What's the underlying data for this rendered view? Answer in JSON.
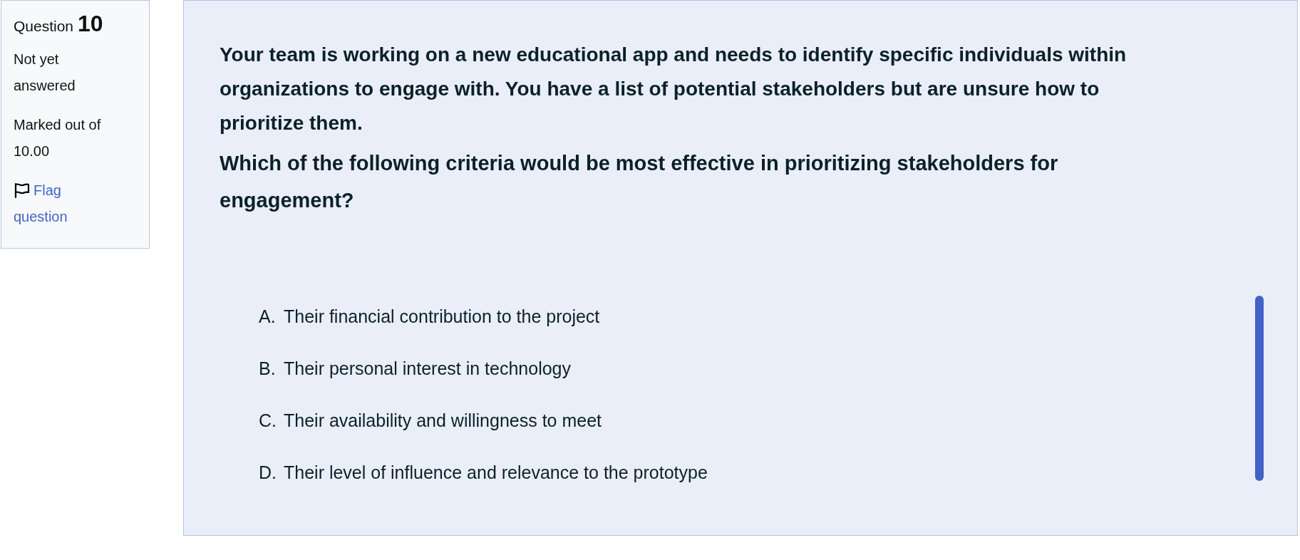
{
  "question_info": {
    "label": "Question",
    "number": "10",
    "status": "Not yet answered",
    "grade": "Marked out of 10.00",
    "flag_link": "Flag question"
  },
  "question": {
    "paragraphs": [
      "Your team is working on a new educational app and needs to identify specific individuals within organizations to engage with. You have a list of potential stakeholders but are unsure how to prioritize them.",
      "Which of the following criteria would be most effective in prioritizing stakeholders for engagement?"
    ]
  },
  "answers": [
    {
      "letter": "A.",
      "text": "Their financial contribution to the project"
    },
    {
      "letter": "B.",
      "text": "Their personal interest in technology"
    },
    {
      "letter": "C.",
      "text": "Their availability and willingness to meet"
    },
    {
      "letter": "D.",
      "text": "Their level of influence and relevance to the prototype"
    }
  ]
}
